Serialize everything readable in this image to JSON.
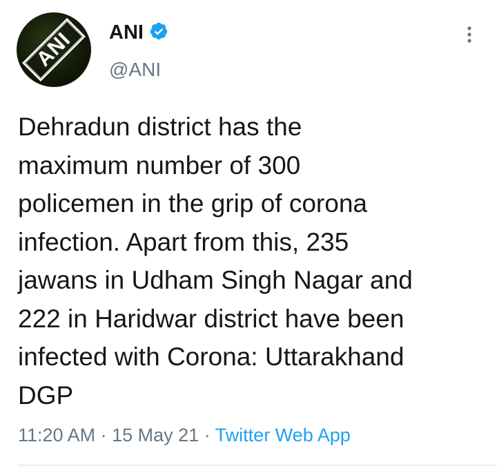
{
  "tweet": {
    "author": {
      "name": "ANI",
      "handle": "@ANI",
      "avatar_label": "ANI",
      "verified": true
    },
    "text": "Dehradun district has the\nmaximum number of 300\npolicemen in the grip of corona\ninfection. Apart from this, 235\njawans in Udham Singh Nagar and\n222 in Haridwar district have been\ninfected with Corona: Uttarakhand\nDGP",
    "time": "11:20 AM",
    "date": "15 May 21",
    "separator": " · ",
    "source": "Twitter Web App"
  },
  "icons": {
    "verified": "verified-badge-icon",
    "more": "more-options-icon"
  },
  "colors": {
    "text": "#14171a",
    "secondary": "#657786",
    "link": "#1da1f2",
    "verified": "#1da1f2",
    "divider": "#d7dde2"
  }
}
